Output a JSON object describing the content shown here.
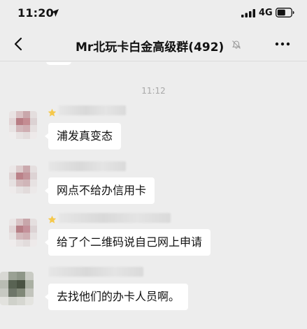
{
  "status_bar": {
    "time": "11:20",
    "network_type": "4G",
    "icons": [
      "location-arrow-icon",
      "signal-icon",
      "battery-icon"
    ]
  },
  "nav": {
    "title": "Mr北玩卡白金高级群(492)",
    "icons": [
      "back-icon",
      "mute-icon",
      "more-icon"
    ]
  },
  "chat": {
    "timestamp": "11:12",
    "messages": [
      {
        "text": "浦发真变态",
        "sender_badge": "star"
      },
      {
        "text": "网点不给办信用卡",
        "sender_badge": "none"
      },
      {
        "text": "给了个二维码说自己网上申请",
        "sender_badge": "star"
      },
      {
        "text": "去找他们的办卡人员啊。",
        "sender_badge": "none"
      }
    ],
    "sender_names_blurred": true
  },
  "colors": {
    "background": "#ededed",
    "bubble": "#ffffff",
    "timestamp": "#a8a8a8",
    "star": "#f5c84b"
  }
}
